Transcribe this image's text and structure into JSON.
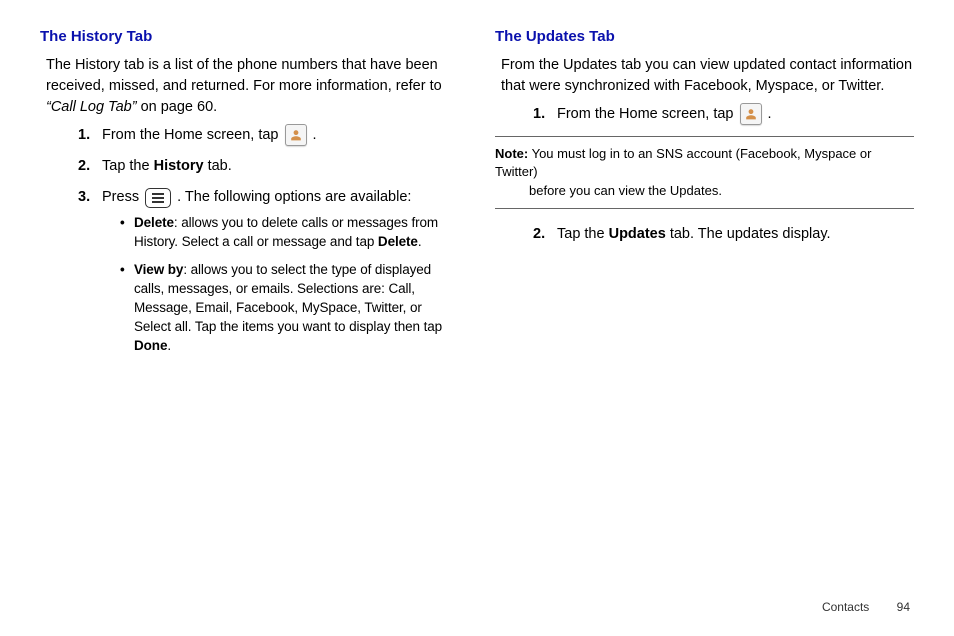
{
  "left": {
    "heading": "The History Tab",
    "intro_1": "The History tab is a list of the phone numbers that have been received, missed, and returned. For more information, refer to ",
    "intro_ref": "“Call Log Tab”",
    "intro_2": "  on page 60.",
    "steps": [
      {
        "num": "1.",
        "before_icon": "From the Home screen, tap ",
        "icon": "contacts",
        "after_icon": " ."
      },
      {
        "num": "2.",
        "text_before": "Tap the ",
        "bold": "History",
        "text_after": " tab."
      },
      {
        "num": "3.",
        "before_icon": "Press ",
        "icon": "menu",
        "after_icon": ". The following options are available:"
      }
    ],
    "bullets": [
      {
        "bold1": "Delete",
        "text1": ": allows you to delete calls or messages from History. Select a call or message and tap ",
        "bold2": "Delete",
        "text2": "."
      },
      {
        "bold1": "View by",
        "text1": ": allows you to select the type of displayed calls, messages, or emails. Selections are: Call, Message, Email, Facebook, MySpace, Twitter, or Select all. Tap the items you want to display then tap ",
        "bold2": "Done",
        "text2": "."
      }
    ]
  },
  "right": {
    "heading": "The Updates Tab",
    "intro": "From the Updates tab you can view updated contact information that were synchronized with Facebook, Myspace, or Twitter.",
    "steps_a": [
      {
        "num": "1.",
        "before_icon": "From the Home screen, tap ",
        "icon": "contacts",
        "after_icon": " ."
      }
    ],
    "note_label": "Note:",
    "note_text_line1": " You must log in to an SNS account (Facebook, Myspace or Twitter)",
    "note_text_line2": "before you can view the Updates.",
    "steps_b": [
      {
        "num": "2.",
        "text_before": "Tap the ",
        "bold": "Updates",
        "text_after": " tab. The updates display."
      }
    ]
  },
  "footer": {
    "section": "Contacts",
    "page": "94"
  }
}
